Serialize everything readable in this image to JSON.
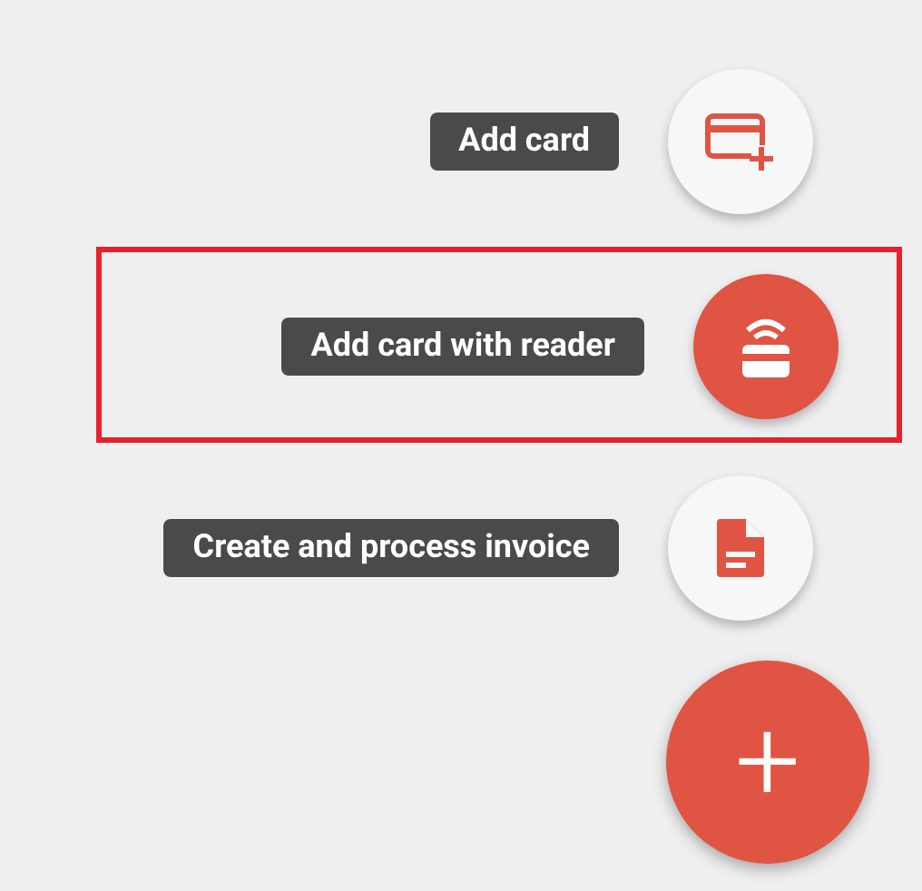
{
  "actions": [
    {
      "label": "Add card",
      "kind": "card-add",
      "selected": false
    },
    {
      "label": "Add card with reader",
      "kind": "reader",
      "selected": true
    },
    {
      "label": "Create and process invoice",
      "kind": "invoice",
      "selected": false
    }
  ],
  "main_button": {
    "label": "+"
  }
}
